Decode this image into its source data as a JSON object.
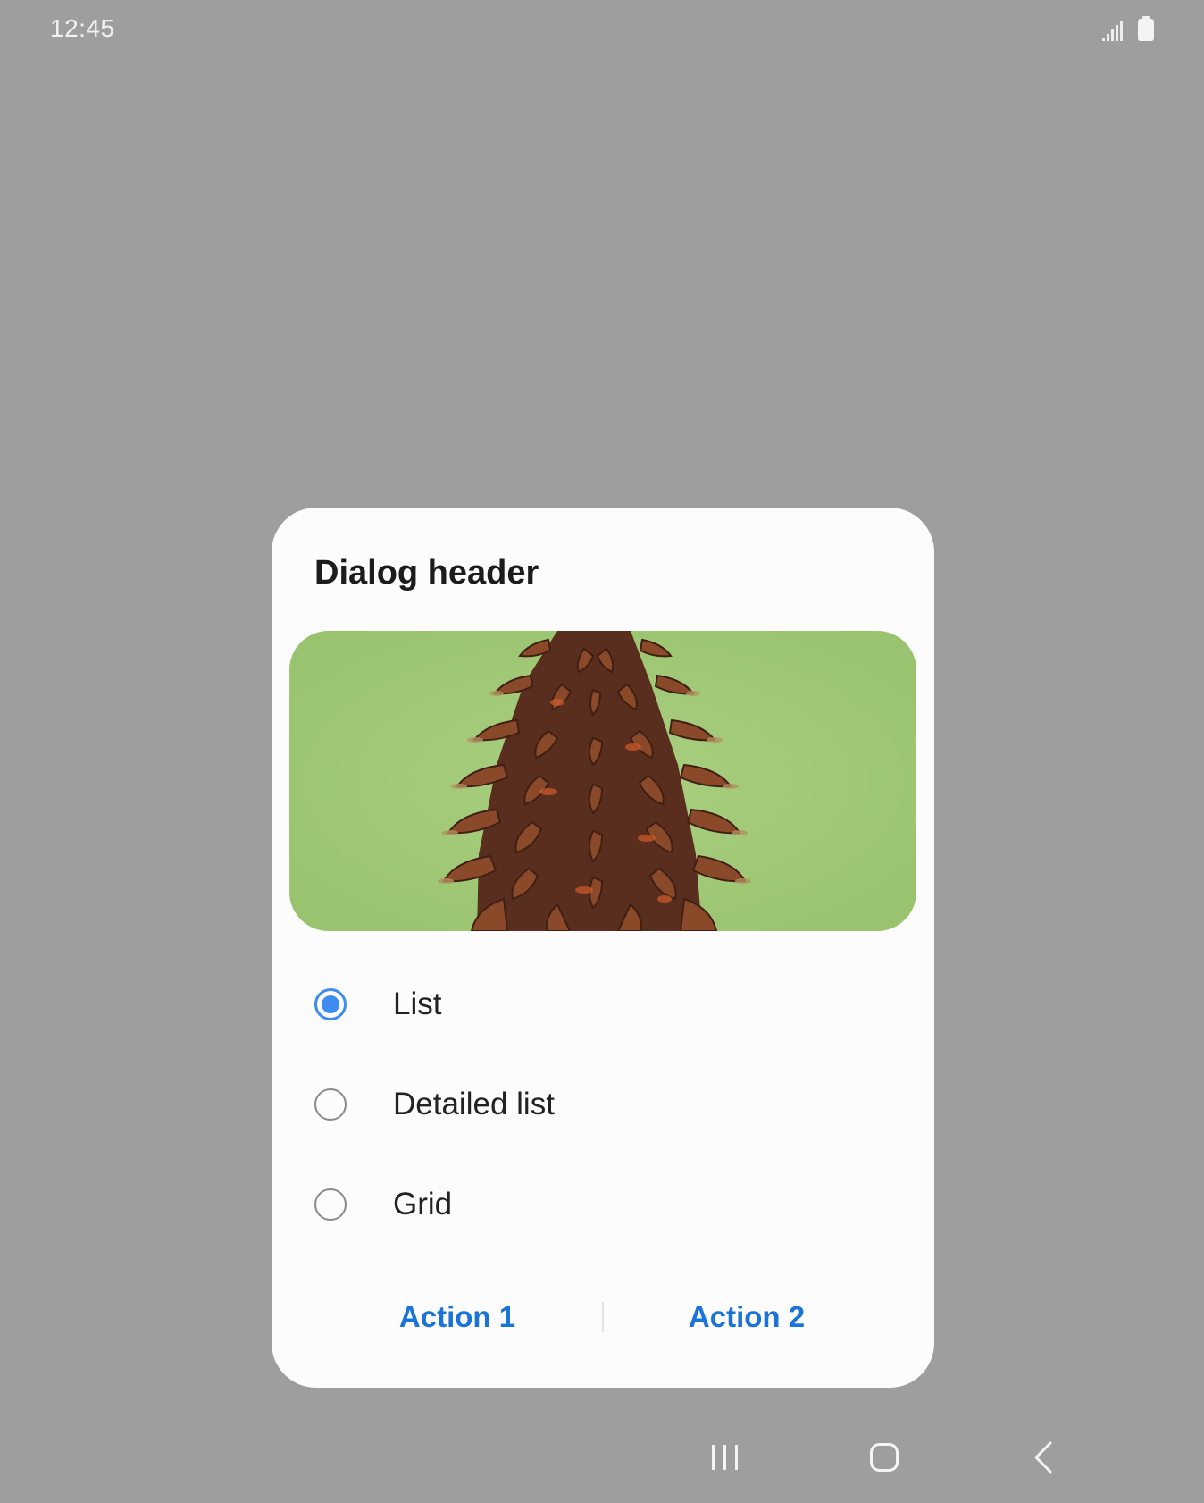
{
  "status_bar": {
    "time": "12:45",
    "signal_icon": "signal-icon",
    "battery_icon": "battery-icon"
  },
  "dialog": {
    "header": "Dialog header",
    "image_icon": "pinecone-photo",
    "options": [
      {
        "label": "List",
        "selected": true
      },
      {
        "label": "Detailed list",
        "selected": false
      },
      {
        "label": "Grid",
        "selected": false
      }
    ],
    "actions": {
      "action1": "Action 1",
      "action2": "Action 2"
    }
  },
  "nav_bar": {
    "recents_icon": "recents-icon",
    "home_icon": "home-icon",
    "back_icon": "back-icon"
  },
  "colors": {
    "background": "#9e9e9e",
    "dialog": "#fcfcfc",
    "accent": "#3e8cf0",
    "action_text": "#1a73d6"
  }
}
